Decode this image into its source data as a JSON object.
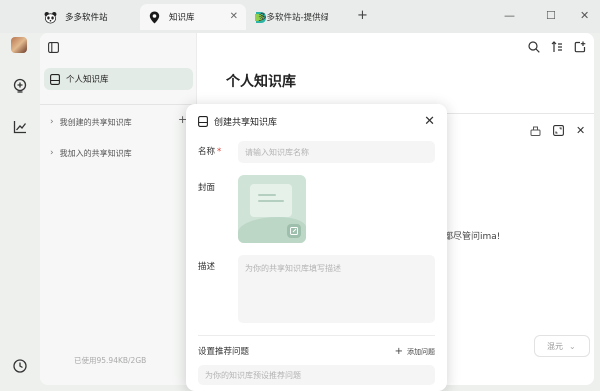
{
  "tabs": [
    {
      "label": "多多软件站",
      "icon": "panda-icon"
    },
    {
      "label": "知识库",
      "icon": "location-pin-icon"
    },
    {
      "label": "多多软件站-提供绿色软件下载",
      "icon": "d-logo-icon"
    }
  ],
  "sidebar": {
    "active_item": "个人知识库",
    "items": [
      {
        "label": "我创建的共享知识库"
      },
      {
        "label": "我加入的共享知识库"
      }
    ],
    "storage": "已使用95.94KB/2GB"
  },
  "main": {
    "title": "个人知识库",
    "side_note": "都尽管问ima!",
    "select_label": "混元"
  },
  "modal": {
    "title": "创建共享知识库",
    "name_label": "名称",
    "required_mark": "*",
    "name_placeholder": "请输入知识库名称",
    "cover_label": "封面",
    "desc_label": "描述",
    "desc_placeholder": "为你的共享知识库填写描述",
    "recommend_label": "设置推荐问题",
    "add_question": "添加问题",
    "question_placeholder": "为你的知识库预设推荐问题"
  },
  "colors": {
    "accent_green": "#cfe3d7",
    "active_item_bg": "#e3ebe6",
    "required": "#e0453a"
  }
}
